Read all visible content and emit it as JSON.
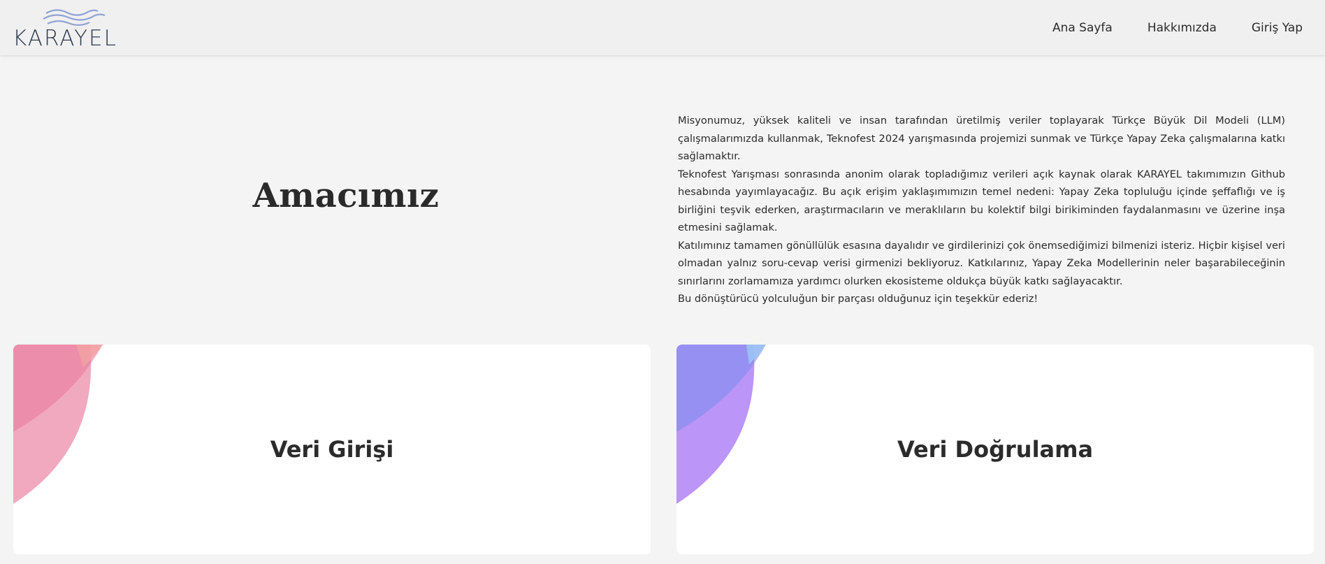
{
  "header": {
    "logo_text": "KARAYEL",
    "nav": [
      "Ana Sayfa",
      "Hakkımızda",
      "Giriş Yap"
    ]
  },
  "hero": {
    "title": "Amacımız",
    "paragraphs": [
      "Misyonumuz, yüksek kaliteli ve insan tarafından üretilmiş veriler toplayarak Türkçe Büyük Dil Modeli (LLM) çalışmalarımızda kullanmak, Teknofest 2024 yarışmasında projemizi sunmak ve Türkçe Yapay Zeka çalışmalarına katkı sağlamaktır.",
      "Teknofest Yarışması sonrasında anonim olarak topladığımız verileri açık kaynak olarak KARAYEL takımımızın Github hesabında yayımlayacağız. Bu açık erişim yaklaşımımızın temel nedeni: Yapay Zeka topluluğu içinde şeffaflığı ve iş birliğini teşvik ederken, araştırmacıların ve meraklıların bu kolektif bilgi birikiminden faydalanmasını ve üzerine inşa etmesini sağlamak.",
      "Katılımınız tamamen gönüllülük esasına dayalıdır ve girdilerinizi çok önemsediğimizi bilmenizi isteriz. Hiçbir kişisel veri olmadan yalnız soru-cevap verisi girmenizi bekliyoruz. Katkılarınız, Yapay Zeka Modellerinin neler başarabileceğinin sınırlarını zorlamamıza yardımcı olurken ekosisteme oldukça büyük katkı sağlayacaktır.",
      "Bu dönüştürücü yolculuğun bir parçası olduğunuz için teşekkür ederiz!"
    ]
  },
  "cards": [
    {
      "title": "Veri Girişi",
      "colors": [
        "#e8789a",
        "#f0a0b8",
        "#ef8a8a"
      ]
    },
    {
      "title": "Veri Doğrulama",
      "colors": [
        "#a97bf5",
        "#8a8cf0",
        "#8fb6f5"
      ]
    }
  ],
  "icons": {
    "logo": "wave-logo-icon"
  }
}
